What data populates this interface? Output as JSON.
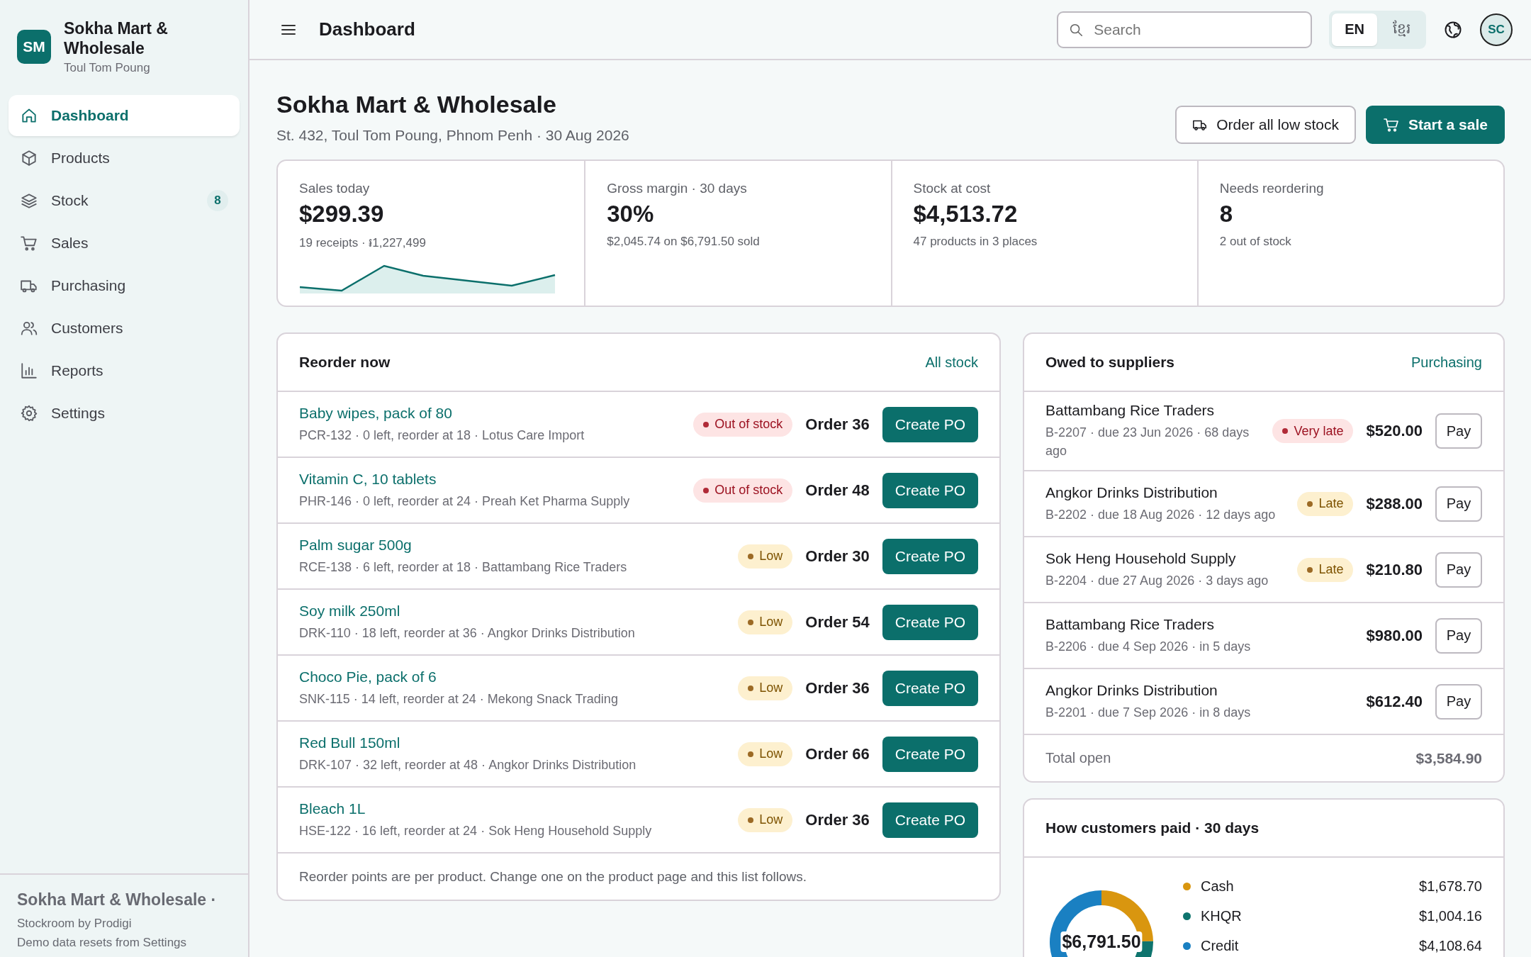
{
  "sidebar": {
    "logo": "SM",
    "store_name": "Sokha Mart & Wholesale",
    "location": "Toul Tom Poung",
    "nav": [
      {
        "label": "Dashboard",
        "selected": true
      },
      {
        "label": "Products",
        "selected": false
      },
      {
        "label": "Stock",
        "selected": false,
        "badge": "8"
      },
      {
        "label": "Sales",
        "selected": false
      },
      {
        "label": "Purchasing",
        "selected": false
      },
      {
        "label": "Customers",
        "selected": false
      },
      {
        "label": "Reports",
        "selected": false
      },
      {
        "label": "Settings",
        "selected": false
      }
    ],
    "footer": {
      "title": "Sokha Mart & Wholesale ·",
      "lines": [
        "Stockroom by Prodigi",
        "Demo data resets from Settings"
      ]
    }
  },
  "topbar": {
    "title": "Dashboard",
    "search": {
      "placeholder": "Search"
    },
    "languages": [
      {
        "label": "EN",
        "selected": true
      },
      {
        "label": "ខ្មែរ",
        "selected": false
      }
    ],
    "avatar": "SC"
  },
  "header": {
    "title": "Sokha Mart & Wholesale",
    "subtitle": "St. 432, Toul Tom Poung, Phnom Penh · 30 Aug 2026",
    "actions": [
      {
        "label": "Order all low stock",
        "kind": "secondary"
      },
      {
        "label": "Start a sale",
        "kind": "primary"
      }
    ]
  },
  "stats": [
    {
      "label": "Sales today",
      "value": "$299.39",
      "note": "19 receipts · ៛1,227,499",
      "kind": "trend"
    },
    {
      "label": "Gross margin · 30 days",
      "value": "30%",
      "note": "$2,045.74 on $6,791.50 sold",
      "kind": "plain"
    },
    {
      "label": "Stock at cost",
      "value": "$4,513.72",
      "note": "47 products in 3 places",
      "kind": "plain"
    },
    {
      "label": "Needs reordering",
      "value": "8",
      "note": "2 out of stock",
      "kind": "plain"
    }
  ],
  "reorder": {
    "title": "Reorder now",
    "link": "All stock",
    "items": [
      {
        "name": "Baby wipes, pack of 80",
        "detail": "PCR-132 · 0 left, reorder at 18 · Lotus Care Import",
        "status": {
          "label": "Out of stock",
          "kind": "out"
        },
        "order": "Order 36",
        "action": "Create PO"
      },
      {
        "name": "Vitamin C, 10 tablets",
        "detail": "PHR-146 · 0 left, reorder at 24 · Preah Ket Pharma Supply",
        "status": {
          "label": "Out of stock",
          "kind": "out"
        },
        "order": "Order 48",
        "action": "Create PO"
      },
      {
        "name": "Palm sugar 500g",
        "detail": "RCE-138 · 6 left, reorder at 18 · Battambang Rice Traders",
        "status": {
          "label": "Low",
          "kind": "low"
        },
        "order": "Order 30",
        "action": "Create PO"
      },
      {
        "name": "Soy milk 250ml",
        "detail": "DRK-110 · 18 left, reorder at 36 · Angkor Drinks Distribution",
        "status": {
          "label": "Low",
          "kind": "low"
        },
        "order": "Order 54",
        "action": "Create PO"
      },
      {
        "name": "Choco Pie, pack of 6",
        "detail": "SNK-115 · 14 left, reorder at 24 · Mekong Snack Trading",
        "status": {
          "label": "Low",
          "kind": "low"
        },
        "order": "Order 36",
        "action": "Create PO"
      },
      {
        "name": "Red Bull 150ml",
        "detail": "DRK-107 · 32 left, reorder at 48 · Angkor Drinks Distribution",
        "status": {
          "label": "Low",
          "kind": "low"
        },
        "order": "Order 66",
        "action": "Create PO"
      },
      {
        "name": "Bleach 1L",
        "detail": "HSE-122 · 16 left, reorder at 24 · Sok Heng Household Supply",
        "status": {
          "label": "Low",
          "kind": "low"
        },
        "order": "Order 36",
        "action": "Create PO"
      }
    ],
    "footnote": "Reorder points are per product. Change one on the product page and this list follows."
  },
  "suppliers": {
    "title": "Owed to suppliers",
    "link": "Purchasing",
    "bills": [
      {
        "name": "Battambang Rice Traders",
        "detail": "B-2207 · due 23 Jun 2026 · 68 days ago",
        "status": {
          "label": "Very late",
          "kind": "very-late"
        },
        "amount": "$520.00",
        "action": "Pay"
      },
      {
        "name": "Angkor Drinks Distribution",
        "detail": "B-2202 · due 18 Aug 2026 · 12 days ago",
        "status": {
          "label": "Late",
          "kind": "late"
        },
        "amount": "$288.00",
        "action": "Pay"
      },
      {
        "name": "Sok Heng Household Supply",
        "detail": "B-2204 · due 27 Aug 2026 · 3 days ago",
        "status": {
          "label": "Late",
          "kind": "late"
        },
        "amount": "$210.80",
        "action": "Pay"
      },
      {
        "name": "Battambang Rice Traders",
        "detail": "B-2206 · due 4 Sep 2026 · in 5 days",
        "amount": "$980.00",
        "action": "Pay"
      },
      {
        "name": "Angkor Drinks Distribution",
        "detail": "B-2201 · due 7 Sep 2026 · in 8 days",
        "amount": "$612.40",
        "action": "Pay"
      }
    ],
    "total_label": "Total open",
    "total_value": "$3,584.90"
  },
  "payments": {
    "title": "How customers paid · 30 days",
    "total": "$6,791.50",
    "legend": [
      {
        "color": "#d9960f",
        "amount": "$1,678.70"
      },
      {
        "color": "#0e746e",
        "amount": "$1,004.16"
      },
      {
        "color": "#1a80c2",
        "amount": "$4,108.64"
      }
    ],
    "chart_data": {
      "type": "donut",
      "categories": [
        "Cash",
        "KHQR",
        "Credit"
      ],
      "values": [
        24.72,
        14.78,
        60.5
      ]
    }
  }
}
